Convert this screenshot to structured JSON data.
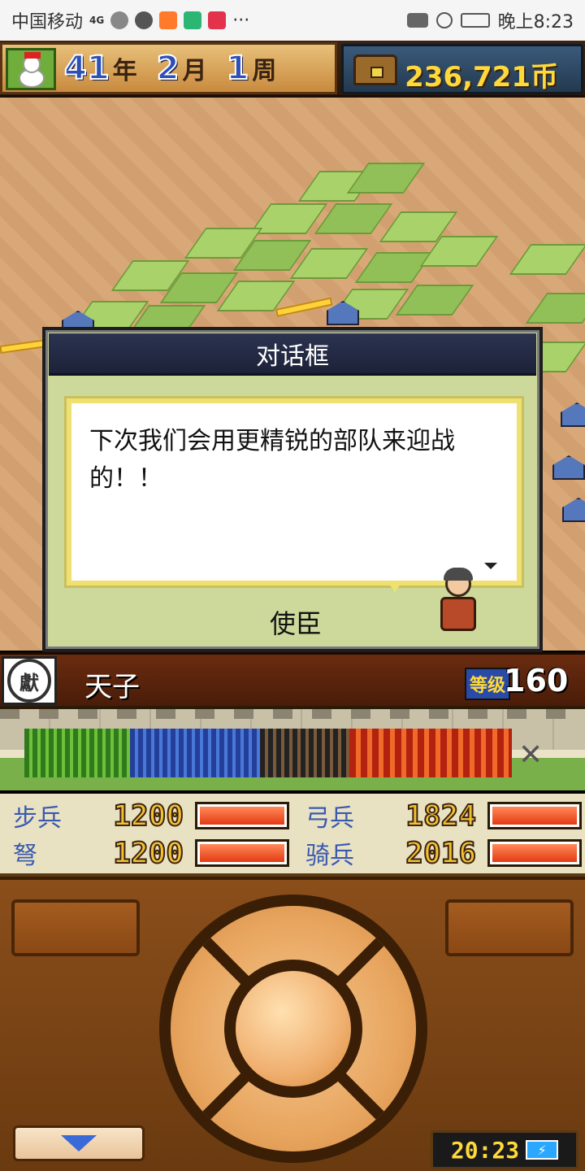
{
  "status_bar": {
    "carrier": "中国移动",
    "network": "4G",
    "time": "晚上8:23"
  },
  "header": {
    "year_value": "41",
    "year_unit": "年",
    "month_value": "2",
    "month_unit": "月",
    "week_value": "1",
    "week_unit": "周",
    "money": "236,721币"
  },
  "dialog": {
    "title": "对话框",
    "message": "下次我们会用更精锐的部队来迎战的！！",
    "speaker": "使臣"
  },
  "unit": {
    "name": "天子",
    "seal_text": "獻",
    "level_label": "等级",
    "level_value": "160"
  },
  "stats": [
    {
      "label": "步兵",
      "value": "1200",
      "fill": 1.0
    },
    {
      "label": "弓兵",
      "value": "1824",
      "fill": 1.0
    },
    {
      "label": "弩",
      "value": "1200",
      "fill": 1.0
    },
    {
      "label": "骑兵",
      "value": "2016",
      "fill": 1.0
    }
  ],
  "clock": {
    "time": "20:23",
    "battery_icon": "charging-battery-icon"
  },
  "colors": {
    "dialog_bg": "#cdd99a",
    "title_bar": "#2c3350",
    "stat_label": "#3a5ab0",
    "bar_fill": "#e43a12"
  }
}
